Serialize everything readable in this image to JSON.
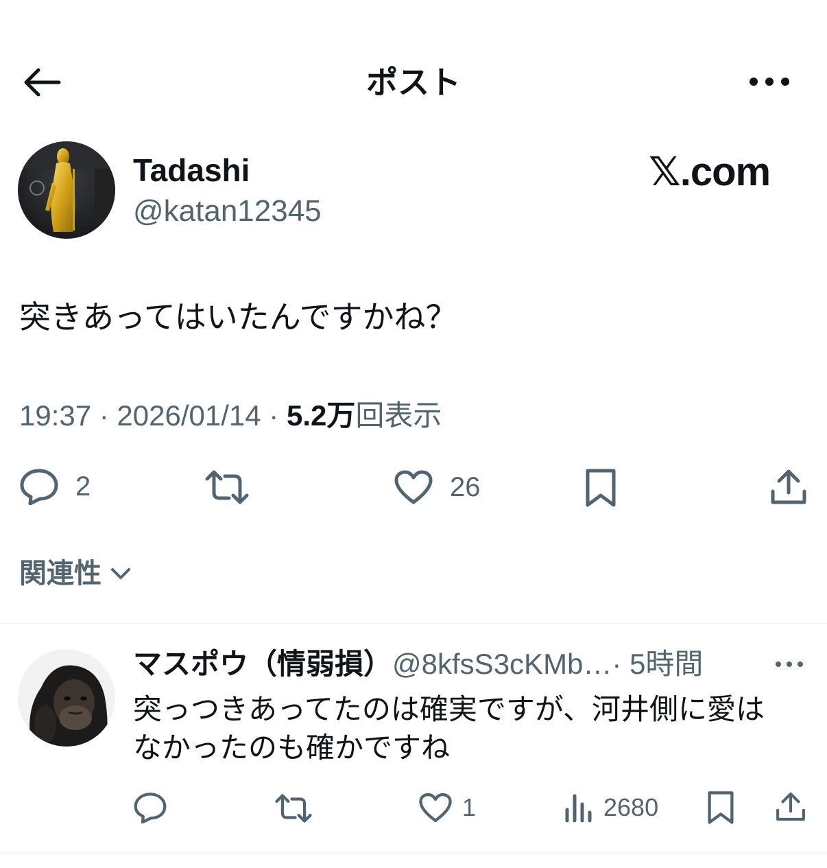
{
  "header": {
    "back_icon": "arrow-left-icon",
    "title": "ポスト",
    "more_icon": "ellipsis-icon"
  },
  "post": {
    "author_name": "Tadashi",
    "author_handle": "@katan12345",
    "watermark": "𝕏.com",
    "text": "突きあってはいたんですかね？",
    "time": "19:37 · 2026/01/14 · ",
    "views_count": "5.2万",
    "views_label": "回表示",
    "actions": {
      "replies": "2",
      "reposts": "",
      "likes": "26"
    }
  },
  "relevance": {
    "label": "関連性"
  },
  "reply": {
    "name": "マスポウ（情弱損）",
    "handle": "@8kfsS3cKMb…",
    "time": "· 5時間",
    "text": "突っつきあってたのは確実ですが、河井側に愛はなかったのも確かですね",
    "actions": {
      "likes": "1",
      "views": "2680"
    }
  },
  "colors": {
    "text_primary": "#0f1419",
    "text_secondary": "#536471",
    "divider": "#eff3f4",
    "background": "#ffffff"
  }
}
